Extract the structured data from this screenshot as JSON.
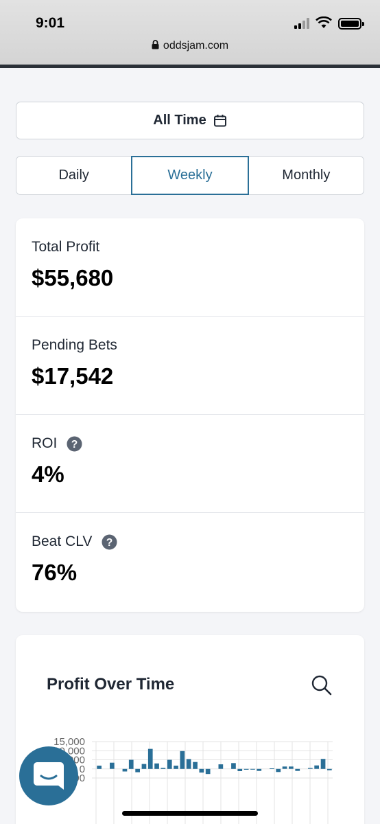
{
  "status": {
    "time": "9:01"
  },
  "browser": {
    "url": "oddsjam.com"
  },
  "filters": {
    "range_label": "All Time",
    "periods": [
      "Daily",
      "Weekly",
      "Monthly"
    ],
    "active_period": "Weekly"
  },
  "stats": [
    {
      "label": "Total Profit",
      "value": "$55,680",
      "help": false
    },
    {
      "label": "Pending Bets",
      "value": "$17,542",
      "help": false
    },
    {
      "label": "ROI",
      "value": "4%",
      "help": true
    },
    {
      "label": "Beat CLV",
      "value": "76%",
      "help": true
    }
  ],
  "chart": {
    "title": "Profit Over Time",
    "accent": "#2a6f97"
  },
  "chart_data": {
    "type": "bar",
    "title": "Profit Over Time",
    "xlabel": "",
    "ylabel": "",
    "ylim": [
      -5000,
      15000
    ],
    "yticks": [
      "15,000",
      "10,000",
      "5,000",
      "0",
      "-5,000"
    ],
    "ytick_values": [
      15000,
      10000,
      5000,
      0,
      -5000
    ],
    "grid": true,
    "values": [
      1800,
      0,
      3400,
      0,
      -1400,
      5000,
      -1800,
      2700,
      11000,
      3000,
      600,
      5000,
      1800,
      9800,
      5400,
      3800,
      -2000,
      -2800,
      0,
      2500,
      0,
      3200,
      -1200,
      -400,
      -300,
      -1100,
      0,
      300,
      -1700,
      1300,
      1300,
      -1100,
      0,
      500,
      1900,
      5500,
      -700
    ],
    "bar_color": "#2a6f97"
  },
  "colors": {
    "primary": "#2a6f97",
    "text": "#1f2733",
    "background": "#f4f5f8"
  }
}
